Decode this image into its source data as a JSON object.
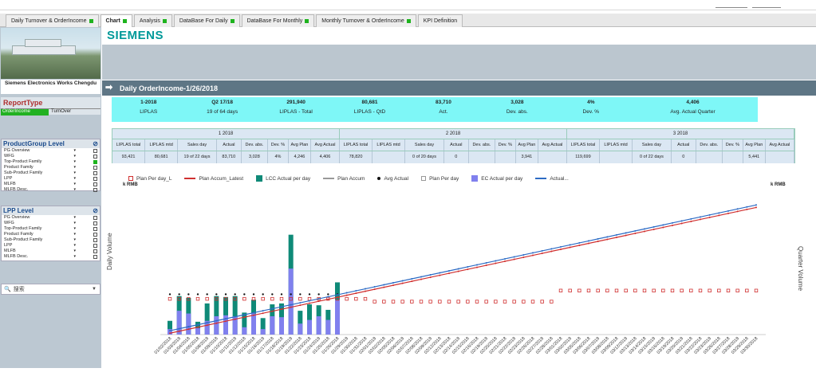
{
  "tabs": [
    {
      "label": "Daily Turnover & OrderIncome",
      "dot": true
    },
    {
      "label": "Chart",
      "dot": true,
      "active": true
    },
    {
      "label": "Analysis",
      "dot": true
    },
    {
      "label": "DataBase For Daily",
      "dot": true
    },
    {
      "label": "DataBase For Monthly",
      "dot": true
    },
    {
      "label": "Monthly Turnover & OrderIncome",
      "dot": true
    },
    {
      "label": "KPI Definition",
      "dot": false
    }
  ],
  "brand": {
    "logo": "SIEMENS",
    "color": "#009999"
  },
  "sidebar": {
    "company": "Siemens Electronics Works Chengdu",
    "report_type": {
      "title": "ReportType",
      "selected": "OrderIncome",
      "other": "TurnOver"
    },
    "pg_level": {
      "title": "ProductGroup Level",
      "items": [
        {
          "label": "PG Overview",
          "checked": false
        },
        {
          "label": "WFG",
          "checked": false
        },
        {
          "label": "Top-Product Family",
          "checked": true
        },
        {
          "label": "Product Family",
          "checked": false
        },
        {
          "label": "Sub-Product Family",
          "checked": false
        },
        {
          "label": "LPP",
          "checked": false
        },
        {
          "label": "MLFB",
          "checked": false
        },
        {
          "label": "MLFB Desc.",
          "checked": false
        }
      ]
    },
    "lpp_level": {
      "title": "LPP Level",
      "items": [
        {
          "label": "PG Overview",
          "checked": false
        },
        {
          "label": "WFG",
          "checked": false
        },
        {
          "label": "Top-Product Family",
          "checked": false
        },
        {
          "label": "Product Family",
          "checked": false
        },
        {
          "label": "Sub-Product Family",
          "checked": false
        },
        {
          "label": "LPP",
          "checked": false
        },
        {
          "label": "MLFB",
          "checked": false
        },
        {
          "label": "MLFB Desc.",
          "checked": false
        }
      ]
    },
    "search": {
      "text": "搜索"
    }
  },
  "header": {
    "title": "Daily OrderIncome-1/26/2018"
  },
  "kpis": [
    {
      "value": "1-2018",
      "label": "LIPLAS"
    },
    {
      "value": "Q2 17/18",
      "label": "19 of 64 days"
    },
    {
      "value": "291,940",
      "label": "LIPLAS - Total"
    },
    {
      "value": "80,681",
      "label": "LIPLAS - QtD"
    },
    {
      "value": "83,710",
      "label": "Act."
    },
    {
      "value": "3,028",
      "label": "Dev. abs."
    },
    {
      "value": "4%",
      "label": "Dev. %"
    },
    {
      "value": "4,406",
      "label": "Avg. Actual Quarter"
    }
  ],
  "table": {
    "months": [
      "1 2018",
      "2 2018",
      "3 2018"
    ],
    "columns": [
      "LIPLAS total",
      "LIPLAS mtd",
      "Sales day",
      "Actual",
      "Dev. abs.",
      "Dev. %",
      "Avg Plan",
      "Avg Actual"
    ],
    "rows": [
      [
        "93,421",
        "80,681",
        "19 of 22 days",
        "83,710",
        "3,028",
        "4%",
        "4,246",
        "4,406"
      ],
      [
        "78,820",
        "",
        "0 of 20 days",
        "0",
        "",
        "",
        "3,941",
        ""
      ],
      [
        "119,699",
        "",
        "0 of 22 days",
        "0",
        "",
        "",
        "5,441",
        ""
      ]
    ]
  },
  "legend": [
    {
      "label": "Plan Per day_L",
      "kind": "sq-open",
      "color": "#d03030"
    },
    {
      "label": "Plan Accum_Latest",
      "kind": "line-dot",
      "color": "#d03030"
    },
    {
      "label": "LCC Actual per day",
      "kind": "bar",
      "color": "#0f8a78"
    },
    {
      "label": "Plan Accum",
      "kind": "line-dot",
      "color": "#999999"
    },
    {
      "label": "Avg Actual",
      "kind": "dot",
      "color": "#111111"
    },
    {
      "label": "Plan Per day",
      "kind": "sq-open",
      "color": "#999999"
    },
    {
      "label": "EC Actual per day",
      "kind": "bar",
      "color": "#8080ee"
    },
    {
      "label": "Actual...",
      "kind": "line-dot",
      "color": "#2d6bc4"
    }
  ],
  "chart_data": {
    "type": "bar",
    "left_unit": "k RMB",
    "right_unit": "k RMB",
    "ylabel": "Daily Volume",
    "y2label": "Quarter Volume",
    "x": [
      "01/02/2018",
      "01/03/2018",
      "01/04/2018",
      "01/05/2018",
      "01/08/2018",
      "01/09/2018",
      "01/10/2018",
      "01/11/2018",
      "01/12/2018",
      "01/15/2018",
      "01/16/2018",
      "01/17/2018",
      "01/18/2018",
      "01/19/2018",
      "01/22/2018",
      "01/23/2018",
      "01/24/2018",
      "01/25/2018",
      "01/26/2018",
      "01/29/2018",
      "01/30/2018",
      "01/31/2018",
      "02/01/2018",
      "02/02/2018",
      "02/05/2018",
      "02/06/2018",
      "02/07/2018",
      "02/08/2018",
      "02/09/2018",
      "02/12/2018",
      "02/13/2018",
      "02/14/2018",
      "02/15/2018",
      "02/16/2018",
      "02/19/2018",
      "02/20/2018",
      "02/21/2018",
      "02/22/2018",
      "02/23/2018",
      "02/26/2018",
      "02/27/2018",
      "02/28/2018",
      "03/01/2018",
      "03/02/2018",
      "03/05/2018",
      "03/06/2018",
      "03/07/2018",
      "03/08/2018",
      "03/09/2018",
      "03/12/2018",
      "03/13/2018",
      "03/14/2018",
      "03/15/2018",
      "03/16/2018",
      "03/19/2018",
      "03/20/2018",
      "03/21/2018",
      "03/22/2018",
      "03/23/2018",
      "03/26/2018",
      "03/27/2018",
      "03/28/2018",
      "03/29/2018",
      "03/30/2018"
    ],
    "series": [
      {
        "name": "LCC Actual per day",
        "color": "#0f8a78",
        "values": [
          1.5,
          4.2,
          4.0,
          1.4,
          3.4,
          4.2,
          4.1,
          4.2,
          2.4,
          3.8,
          1.8,
          3.3,
          3.4,
          10.9,
          2.6,
          3.3,
          3.2,
          2.7,
          5.7
        ]
      },
      {
        "name": "EC Actual per day",
        "color": "#8080ee",
        "values": [
          0.6,
          2.6,
          2.3,
          0.7,
          1.5,
          2.0,
          2.1,
          2.0,
          0.8,
          2.3,
          0.6,
          2.0,
          1.9,
          7.2,
          1.2,
          1.6,
          2.0,
          1.6,
          3.8
        ]
      },
      {
        "name": "Plan Per day_L",
        "color": "#d03030",
        "values": [
          3.9,
          3.9,
          3.9,
          3.9,
          3.9,
          3.9,
          3.9,
          3.9,
          3.9,
          3.9,
          3.9,
          3.9,
          3.9,
          3.9,
          3.9,
          3.9,
          3.9,
          3.9,
          3.9,
          3.9,
          3.9,
          3.9,
          3.6,
          3.6,
          3.6,
          3.6,
          3.6,
          3.6,
          3.6,
          3.6,
          3.6,
          3.6,
          3.6,
          3.6,
          3.6,
          3.6,
          3.6,
          3.6,
          3.6,
          3.6,
          3.6,
          3.6,
          4.8,
          4.8,
          4.8,
          4.8,
          4.8,
          4.8,
          4.8,
          4.8,
          4.8,
          4.8,
          4.8,
          4.8,
          4.8,
          4.8,
          4.8,
          4.8,
          4.8,
          4.8,
          4.8,
          4.8,
          4.8,
          4.8
        ]
      },
      {
        "name": "Avg Actual",
        "color": "#111111",
        "values": [
          4.4,
          4.4,
          4.4,
          4.4,
          4.4,
          4.4,
          4.4,
          4.4,
          4.4,
          4.4,
          4.4,
          4.4,
          4.4,
          4.4,
          4.4,
          4.4,
          4.4,
          4.4,
          4.4
        ]
      }
    ],
    "accum": {
      "name": "Plan Accum_Latest",
      "color": "#d03030",
      "start": 5,
      "end": 292
    },
    "accum_actual": {
      "name": "Actual...",
      "color": "#2d6bc4",
      "start": 7,
      "end": 294
    }
  }
}
